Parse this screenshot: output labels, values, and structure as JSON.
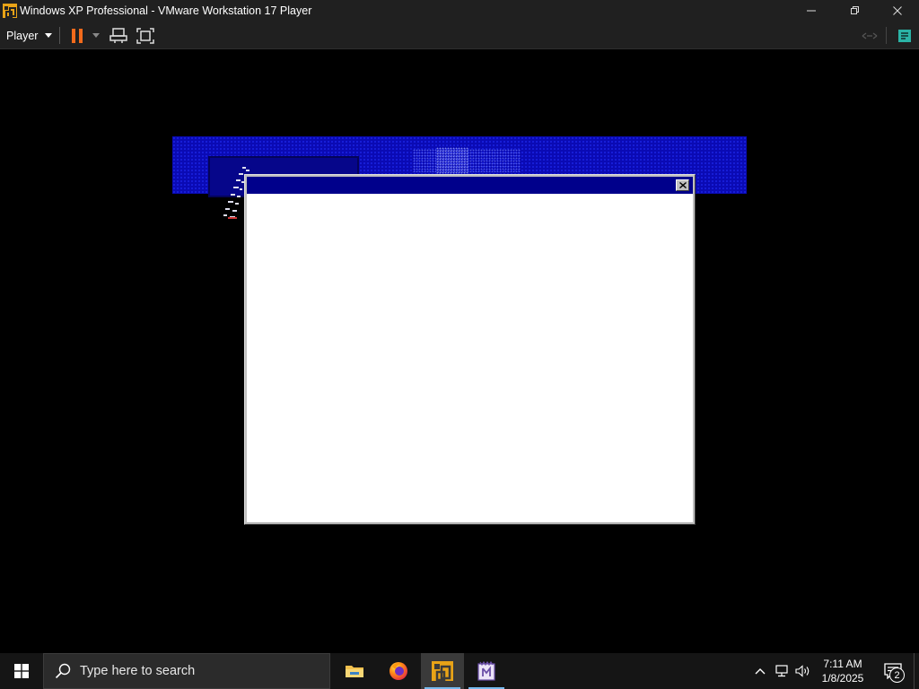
{
  "window": {
    "title": "Windows XP Professional - VMware Workstation 17 Player",
    "logo_icon": "vmware-logo-icon",
    "controls": [
      "minimize-icon",
      "restore-icon",
      "close-icon"
    ]
  },
  "toolbar": {
    "player_label": "Player",
    "buttons": [
      "pause-icon",
      "dropdown-arrow-icon",
      "send-ctrl-alt-del-icon",
      "fullscreen-icon",
      "unity-icon",
      "notes-icon"
    ]
  },
  "guest": {
    "background": "#000000",
    "band_color": "#0a0ab4",
    "dialog": {
      "title": "",
      "title_color": "#00008b",
      "close_icon": "close-icon"
    }
  },
  "taskbar": {
    "search_placeholder": "Type here to search",
    "apps": [
      {
        "name": "File Explorer",
        "icon": "folder-icon"
      },
      {
        "name": "Firefox",
        "icon": "firefox-icon"
      },
      {
        "name": "VMware Workstation Player",
        "icon": "vmware-icon",
        "active": true
      },
      {
        "name": "Installer",
        "icon": "installer-icon"
      }
    ],
    "clock_time": "7:11 AM",
    "clock_date": "1/8/2025",
    "notification_count": "2",
    "accent": "#76b9ed"
  }
}
